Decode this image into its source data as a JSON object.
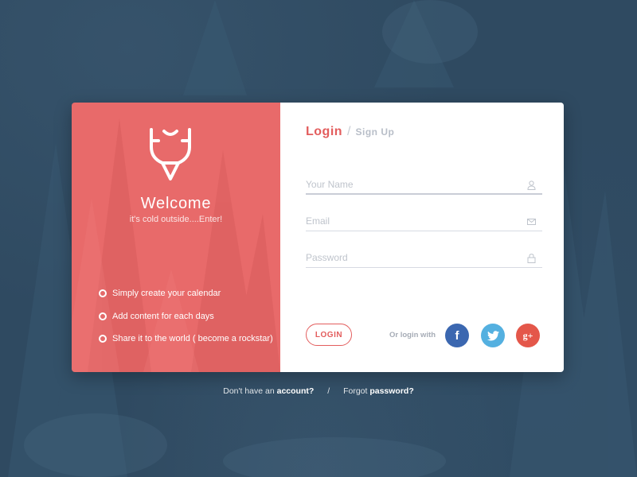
{
  "colors": {
    "background": "#2f4a61",
    "accent": "#e86a6a",
    "login_accent": "#e35d5d",
    "facebook": "#3b67b0",
    "twitter": "#54b0e0",
    "googleplus": "#e4574a"
  },
  "welcome": {
    "logo_icon": "antlers-logo-icon",
    "title": "Welcome",
    "subtitle": "it's cold outside....Enter!",
    "features": [
      "Simply create your calendar",
      "Add content for each days",
      "Share it to the world ( become a rockstar)"
    ]
  },
  "auth": {
    "tabs": {
      "login": "Login",
      "separator": "/",
      "signup": "Sign Up"
    },
    "fields": {
      "name": {
        "placeholder": "Your Name",
        "value": "",
        "icon": "user-icon"
      },
      "email": {
        "placeholder": "Email",
        "value": "",
        "icon": "mail-icon"
      },
      "password": {
        "placeholder": "Password",
        "value": "",
        "icon": "lock-icon"
      }
    },
    "login_button": "LOGIN",
    "or_login_with": "Or login with",
    "social": {
      "facebook": "f",
      "twitter": "twitter-icon",
      "googleplus": "g+"
    }
  },
  "footer": {
    "no_account_prefix": "Don't have  an ",
    "no_account_link": "account?",
    "separator": "/",
    "forgot_prefix": "Forgot ",
    "forgot_link": "password?"
  }
}
